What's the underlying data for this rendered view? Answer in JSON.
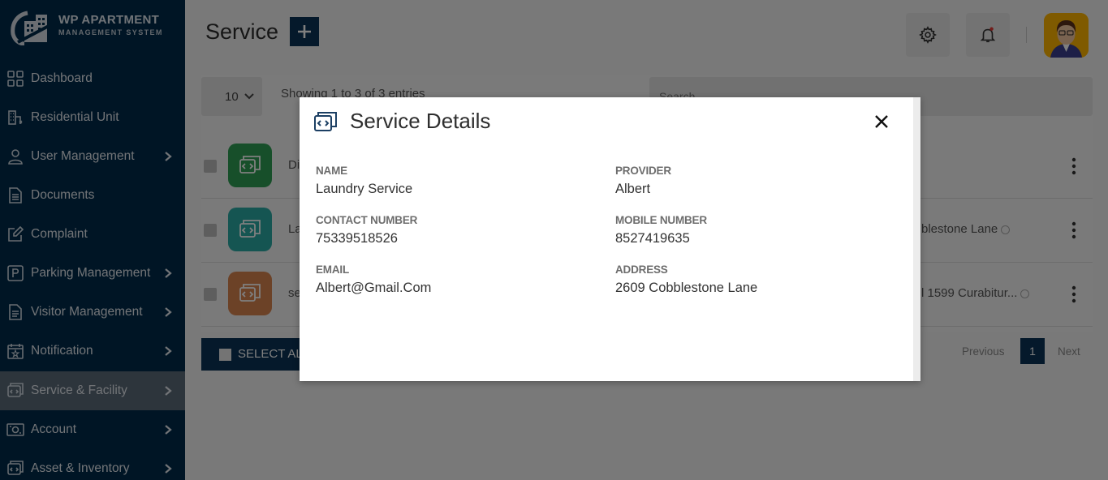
{
  "brand": {
    "title": "WP APARTMENT",
    "subtitle": "MANAGEMENT SYSTEM"
  },
  "sidebar": {
    "items": [
      {
        "label": "Dashboard",
        "icon": "dashboard-grid-icon"
      },
      {
        "label": "Residential Unit",
        "icon": "building-icon"
      },
      {
        "label": "User Management",
        "icon": "user-icon"
      },
      {
        "label": "Documents",
        "icon": "document-icon"
      },
      {
        "label": "Complaint",
        "icon": "edit-icon"
      },
      {
        "label": "Parking Management",
        "icon": "parking-icon"
      },
      {
        "label": "Visitor Management",
        "icon": "visitor-file-icon"
      },
      {
        "label": "Notification",
        "icon": "calendar-star-icon"
      },
      {
        "label": "Service & Facility",
        "icon": "service-icon"
      },
      {
        "label": "Account",
        "icon": "money-icon"
      },
      {
        "label": "Asset & Inventory",
        "icon": "asset-icon"
      }
    ],
    "active": "Service & Facility"
  },
  "header": {
    "title": "Service",
    "add_label": "+"
  },
  "table": {
    "length_value": "10",
    "showing": "Showing 1 to 3 of 3 entries",
    "search_placeholder": "Search",
    "rows": [
      {
        "name": "Di",
        "address": "",
        "thumb_color": "#2e9f54"
      },
      {
        "name": "La",
        "address": "blestone Lane",
        "thumb_color": "#2aaaa5"
      },
      {
        "name": "se",
        "address": "l 1599 Curabitur...",
        "thumb_color": "#d9854f"
      }
    ],
    "select_all": "SELECT AL",
    "pager": {
      "prev": "Previous",
      "page": "1",
      "next": "Next"
    }
  },
  "modal": {
    "title": "Service Details",
    "fields": {
      "name_label": "NAME",
      "name_value": "Laundry Service",
      "provider_label": "PROVIDER",
      "provider_value": "Albert",
      "contact_label": "CONTACT NUMBER",
      "contact_value": "75339518526",
      "mobile_label": "MOBILE NUMBER",
      "mobile_value": "8527419635",
      "email_label": "EMAIL",
      "email_value": "Albert@Gmail.Com",
      "address_label": "ADDRESS",
      "address_value": "2609 Cobblestone Lane"
    }
  },
  "colors": {
    "sidebar_bg": "#002b4a",
    "accent": "#0a3356",
    "active_item": "#5a6a78"
  }
}
